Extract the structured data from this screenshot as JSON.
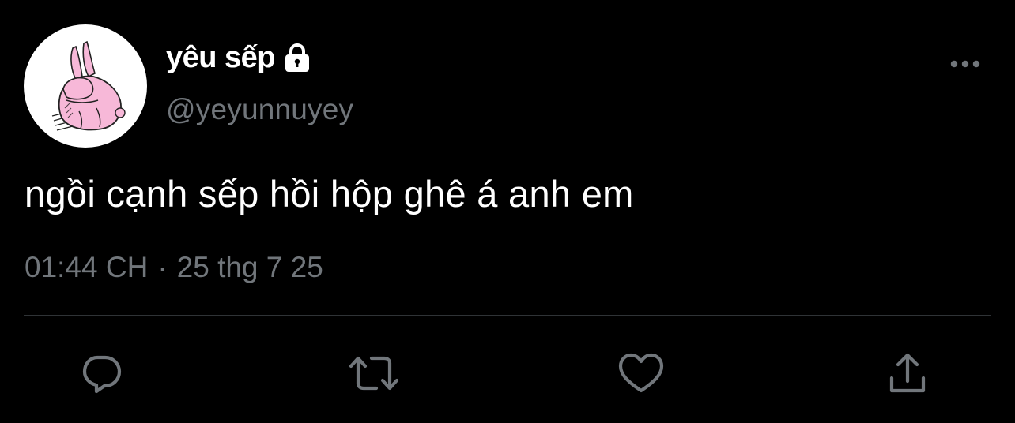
{
  "tweet": {
    "display_name": "yêu sếp",
    "handle": "@yeyunnuyey",
    "text": "ngồi cạnh sếp hồi hộp ghê á anh em",
    "time": "01:44 CH",
    "separator": "·",
    "date": "25 thg 7 25",
    "protected_icon": "lock-icon",
    "avatar_description_icon": "pink-rabbit-avatar"
  },
  "actions": [
    {
      "icon": "reply-icon"
    },
    {
      "icon": "retweet-icon"
    },
    {
      "icon": "like-icon"
    },
    {
      "icon": "share-icon"
    }
  ],
  "colors": {
    "background": "#000000",
    "primary_text": "#ffffff",
    "secondary_text": "#71767b",
    "divider": "#2f3336",
    "avatar_bg": "#ffffff",
    "avatar_rabbit": "#f7b8d8"
  }
}
